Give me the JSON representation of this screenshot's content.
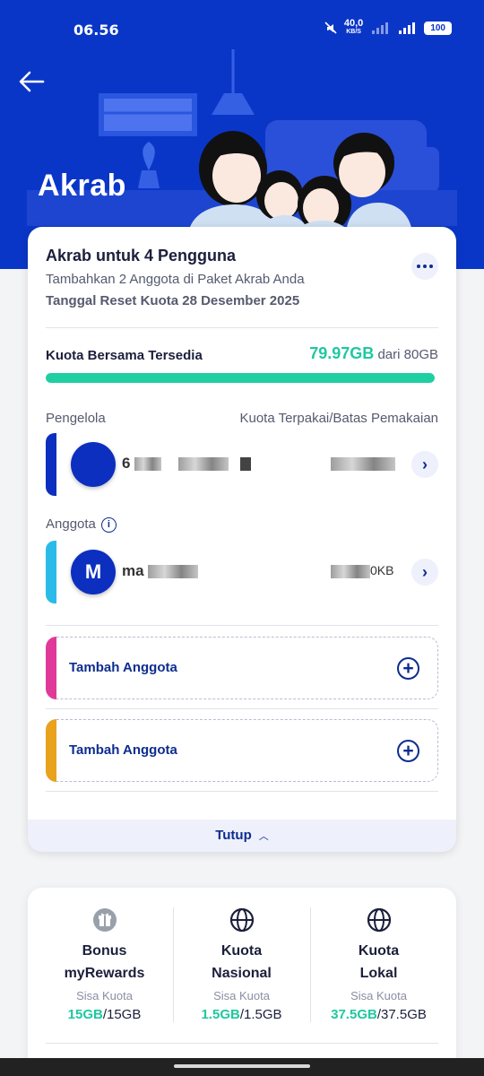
{
  "status_bar": {
    "time": "06.56",
    "speed_value": "40,0",
    "speed_unit": "KB/S",
    "battery": "100"
  },
  "header": {
    "title": "Akrab"
  },
  "plan": {
    "title": "Akrab untuk 4 Pengguna",
    "subtitle": "Tambahkan 2 Anggota di Paket Akrab Anda",
    "reset_date": "Tanggal Reset Kuota 28 Desember 2025"
  },
  "shared_quota": {
    "label": "Kuota Bersama Tersedia",
    "available": "79.97GB",
    "total_text": "dari 80GB",
    "fraction_available": 0.9996
  },
  "manager": {
    "section_label": "Pengelola",
    "usage_header": "Kuota Terpakai/Batas Pemakaian",
    "name_prefix": "6"
  },
  "members": {
    "section_label": "Anggota",
    "info_icon": "i",
    "items": [
      {
        "avatar_letter": "M",
        "name_prefix": "ma",
        "usage_suffix": "0KB"
      }
    ]
  },
  "add_slots": [
    {
      "label": "Tambah Anggota",
      "accent": "#e0399a"
    },
    {
      "label": "Tambah Anggota",
      "accent": "#e8a21c"
    }
  ],
  "close": {
    "label": "Tutup"
  },
  "quota_breakdown": [
    {
      "icon": "gift-icon",
      "title_line1": "Bonus",
      "title_line2": "myRewards",
      "sub": "Sisa Kuota",
      "remaining": "15GB",
      "total": "/15GB"
    },
    {
      "icon": "globe-icon",
      "title_line1": "Kuota",
      "title_line2": "Nasional",
      "sub": "Sisa Kuota",
      "remaining": "1.5GB",
      "total": "/1.5GB"
    },
    {
      "icon": "globe-icon",
      "title_line1": "Kuota",
      "title_line2": "Lokal",
      "sub": "Sisa Kuota",
      "remaining": "37.5GB",
      "total": "/37.5GB"
    }
  ],
  "colors": {
    "brand_blue": "#0a36c8",
    "navy": "#0d2d8f",
    "quota_green": "#1fc8a0",
    "manager_accent": "#0d2fc0",
    "member_accent": "#2bbbe8"
  }
}
